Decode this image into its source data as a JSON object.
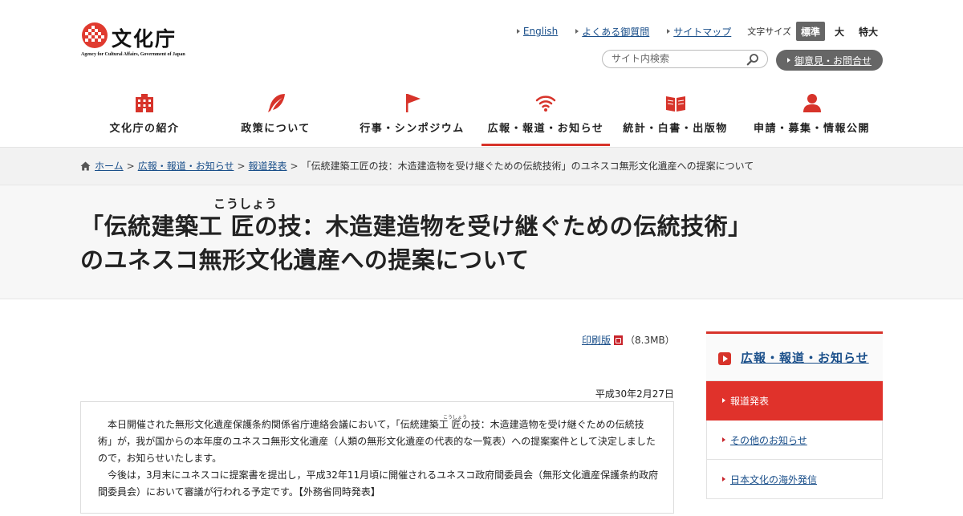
{
  "header": {
    "logo_name": "文化庁",
    "logo_sub": "Agency for Cultural Affairs, Government of Japan",
    "util_links": [
      "English",
      "よくある御質問",
      "サイトマップ"
    ],
    "font_size_label": "文字サイズ",
    "font_sizes": [
      "標準",
      "大",
      "特大"
    ],
    "font_size_selected": "標準",
    "search_placeholder": "サイト内検索",
    "opinion_label": "御意見・お問合せ"
  },
  "gnav": [
    {
      "label": "文化庁の紹介",
      "icon": "building-icon"
    },
    {
      "label": "政策について",
      "icon": "quill-icon"
    },
    {
      "label": "行事・シンポジウム",
      "icon": "flag-icon"
    },
    {
      "label": "広報・報道・お知らせ",
      "icon": "wifi-icon",
      "active": true
    },
    {
      "label": "統計・白書・出版物",
      "icon": "book-icon"
    },
    {
      "label": "申請・募集・情報公開",
      "icon": "person-icon"
    }
  ],
  "breadcrumb": {
    "items": [
      "ホーム",
      "広報・報道・お知らせ",
      "報道発表"
    ],
    "current": "「伝統建築工匠の技：木造建造物を受け継ぐための伝統技術」のユネスコ無形文化遺産への提案について"
  },
  "page": {
    "title_line1": "「伝統建築工 匠の技：木造建造物を受け継ぐための伝統技術」",
    "title_line2": "のユネスコ無形文化遺産への提案について",
    "title_ruby": "こうしょう",
    "print_label": "印刷版",
    "print_size": "（8.3MB）",
    "date": "平成30年2月27日",
    "body_ruby": "こうしょう",
    "body_lines": [
      "　本日開催された無形文化遺産保護条約関係省庁連絡会議において，「伝統建築工 匠の技：木造建造物を受け継ぐための伝統技",
      "術」が，我が国からの本年度のユネスコ無形文化遺産（人類の無形文化遺産の代表的な一覧表）への提案案件として決定しました",
      "ので，お知らせいたします。",
      "　今後は，3月末にユネスコに提案書を提出し，平成32年11月頃に開催されるユネスコ政府間委員会（無形文化遺産保護条約政府",
      "間委員会）において審議が行われる予定です。【外務省同時発表】"
    ]
  },
  "sidebar": {
    "heading": "広報・報道・お知らせ",
    "items": [
      {
        "label": "報道発表",
        "active": true
      },
      {
        "label": "その他のお知らせ"
      },
      {
        "label": "日本文化の海外発信"
      }
    ]
  },
  "colors": {
    "accent": "#d7332a",
    "link": "#1a4f8a",
    "pill": "#666666"
  }
}
